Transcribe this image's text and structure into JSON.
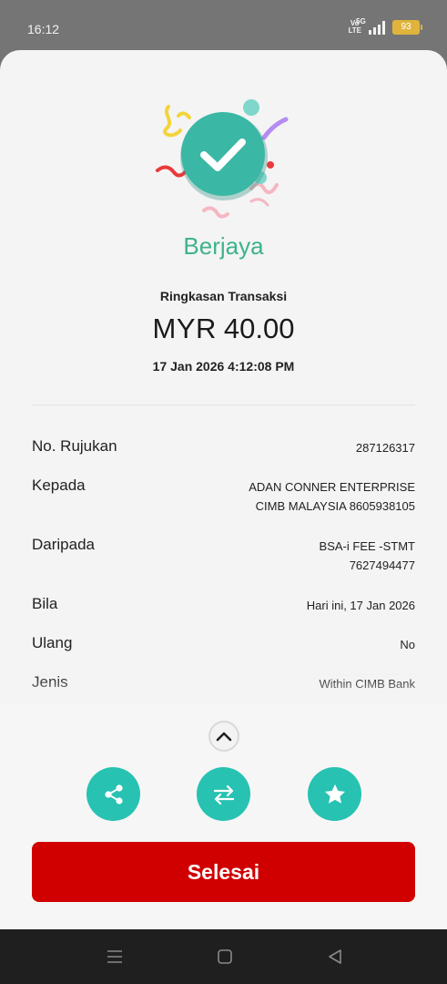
{
  "status_bar": {
    "time": "16:12",
    "volte": "Vo LTE",
    "network": "5G",
    "battery": "93",
    "battery_color": "#e0b43c"
  },
  "result": {
    "icon": "check-circle-icon",
    "status": "Berjaya",
    "status_color": "#3cb489",
    "summary_label": "Ringkasan Transaksi",
    "currency": "MYR",
    "amount": "40.00",
    "datetime": "17 Jan 2026 4:12:08 PM"
  },
  "details": {
    "ref": {
      "label": "No. Rujukan",
      "value": "287126317"
    },
    "to": {
      "label": "Kepada",
      "line1": "ADAN CONNER ENTERPRISE",
      "line2": "CIMB MALAYSIA 8605938105"
    },
    "from": {
      "label": "Daripada",
      "line1": "BSA-i FEE -STMT",
      "line2": "7627494477"
    },
    "when": {
      "label": "Bila",
      "value": "Hari ini, 17 Jan 2026"
    },
    "repeat": {
      "label": "Ulang",
      "value": "No"
    },
    "type": {
      "label": "Jenis",
      "value": "Within CIMB Bank"
    }
  },
  "actions": {
    "collapse_icon": "chevron-up-icon",
    "share_icon": "share-icon",
    "transfer_icon": "transfer-icon",
    "favourite_icon": "star-icon",
    "accent": "#27c2b1",
    "done_label": "Selesai",
    "done_color": "#d00000"
  },
  "nav": {
    "menu_icon": "menu-icon",
    "home_icon": "home-square-icon",
    "back_icon": "back-triangle-icon"
  }
}
